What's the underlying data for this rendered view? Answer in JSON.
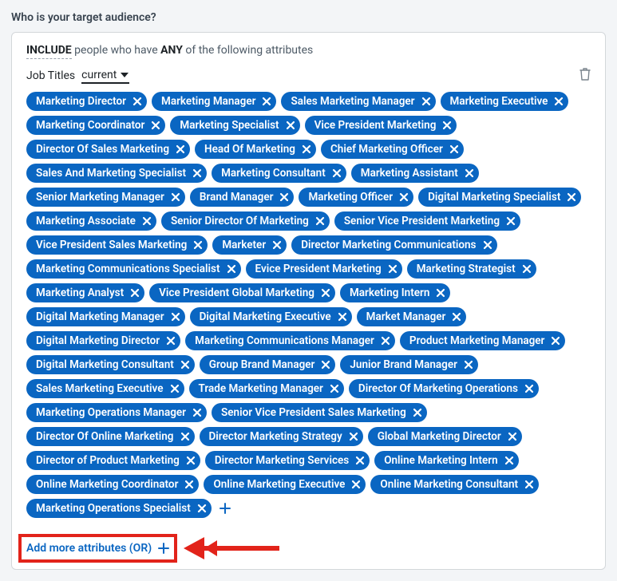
{
  "section_title": "Who is your target audience?",
  "rule": {
    "include_word": "INCLUDE",
    "mid_text": "people who have",
    "any_word": "ANY",
    "trail_text": "of the following attributes"
  },
  "attribute": {
    "name": "Job Titles",
    "scope": "current",
    "delete_icon": "trash-icon"
  },
  "pills": [
    "Marketing Director",
    "Marketing Manager",
    "Sales Marketing Manager",
    "Marketing Executive",
    "Marketing Coordinator",
    "Marketing Specialist",
    "Vice President Marketing",
    "Director Of Sales Marketing",
    "Head Of Marketing",
    "Chief Marketing Officer",
    "Sales And Marketing Specialist",
    "Marketing Consultant",
    "Marketing Assistant",
    "Senior Marketing Manager",
    "Brand Manager",
    "Marketing Officer",
    "Digital Marketing Specialist",
    "Marketing Associate",
    "Senior Director Of Marketing",
    "Senior Vice President Marketing",
    "Vice President Sales Marketing",
    "Marketer",
    "Director Marketing Communications",
    "Marketing Communications Specialist",
    "Evice President Marketing",
    "Marketing Strategist",
    "Marketing Analyst",
    "Vice President Global Marketing",
    "Marketing Intern",
    "Digital Marketing Manager",
    "Digital Marketing Executive",
    "Market Manager",
    "Digital Marketing Director",
    "Marketing Communications Manager",
    "Product Marketing Manager",
    "Digital Marketing Consultant",
    "Group Brand Manager",
    "Junior Brand Manager",
    "Sales Marketing Executive",
    "Trade Marketing Manager",
    "Director Of Marketing Operations",
    "Marketing Operations Manager",
    "Senior Vice President Sales Marketing",
    "Director Of Online Marketing",
    "Director Marketing Strategy",
    "Global Marketing Director",
    "Director of Product Marketing",
    "Director Marketing Services",
    "Online Marketing Intern",
    "Online Marketing Coordinator",
    "Online Marketing Executive",
    "Online Marketing Consultant",
    "Marketing Operations Specialist"
  ],
  "add_more_label": "Add more attributes (OR)",
  "colors": {
    "brand_blue": "#0a66c2",
    "annotation_red": "#e2231a"
  }
}
